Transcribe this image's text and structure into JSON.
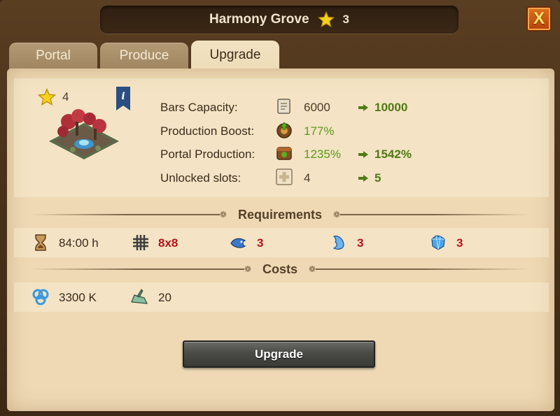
{
  "window": {
    "title": "Harmony Grove",
    "star_count": "3",
    "close_label": "X"
  },
  "tabs": [
    {
      "label": "Portal",
      "active": false
    },
    {
      "label": "Produce",
      "active": false
    },
    {
      "label": "Upgrade",
      "active": true
    }
  ],
  "building": {
    "level": "4",
    "info_label": "i"
  },
  "stats": [
    {
      "label": "Bars Capacity:",
      "icon": "scroll-icon",
      "value": "6000",
      "new_value": "10000"
    },
    {
      "label": "Production Boost:",
      "icon": "production-boost-icon",
      "value": "177%",
      "new_value": ""
    },
    {
      "label": "Portal Production:",
      "icon": "portal-production-icon",
      "value": "1235%",
      "new_value": "1542%"
    },
    {
      "label": "Unlocked slots:",
      "icon": "slot-icon",
      "value": "4",
      "new_value": "5"
    }
  ],
  "requirements": {
    "title": "Requirements",
    "time": "84:00 h",
    "size": "8x8",
    "item1": "3",
    "item2": "3",
    "item3": "3"
  },
  "costs": {
    "title": "Costs",
    "mana": "3300 K",
    "workers": "20"
  },
  "upgrade_button": "Upgrade",
  "colors": {
    "panel": "#eed9b4",
    "green_value": "#5c9a1c",
    "bold_green": "#4f7a14",
    "red_value": "#b0141a"
  }
}
